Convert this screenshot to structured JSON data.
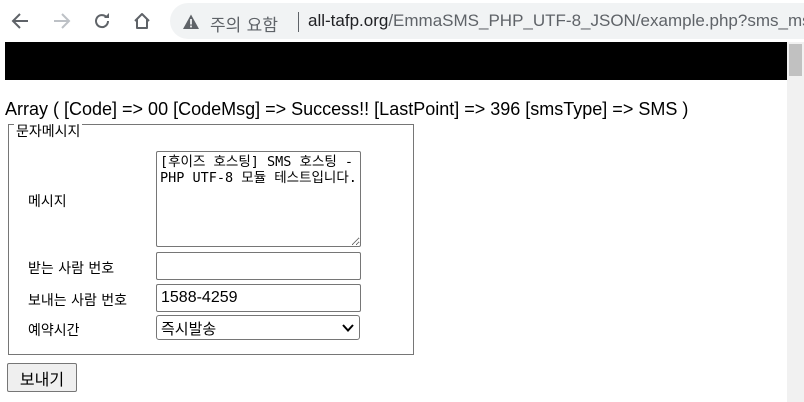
{
  "browser": {
    "security_warning": "주의 요함",
    "url_domain": "all-tafp.org",
    "url_path": "/EmmaSMS_PHP_UTF-8_JSON/example.php?sms_ms"
  },
  "result_line": "Array ( [Code] => 00 [CodeMsg] => Success!! [LastPoint] => 396 [smsType] => SMS )",
  "form": {
    "legend": "문자메시지",
    "message_label": "메시지",
    "message_value": "[후이즈 호스팅] SMS 호스팅 - PHP UTF-8 모듈 테스트입니다.",
    "recipient_label": "받는 사람 번호",
    "recipient_value": "",
    "sender_label": "보내는 사람 번호",
    "sender_value": "1588-4259",
    "schedule_label": "예약시간",
    "schedule_value": "즉시발송",
    "send_label": "보내기"
  }
}
